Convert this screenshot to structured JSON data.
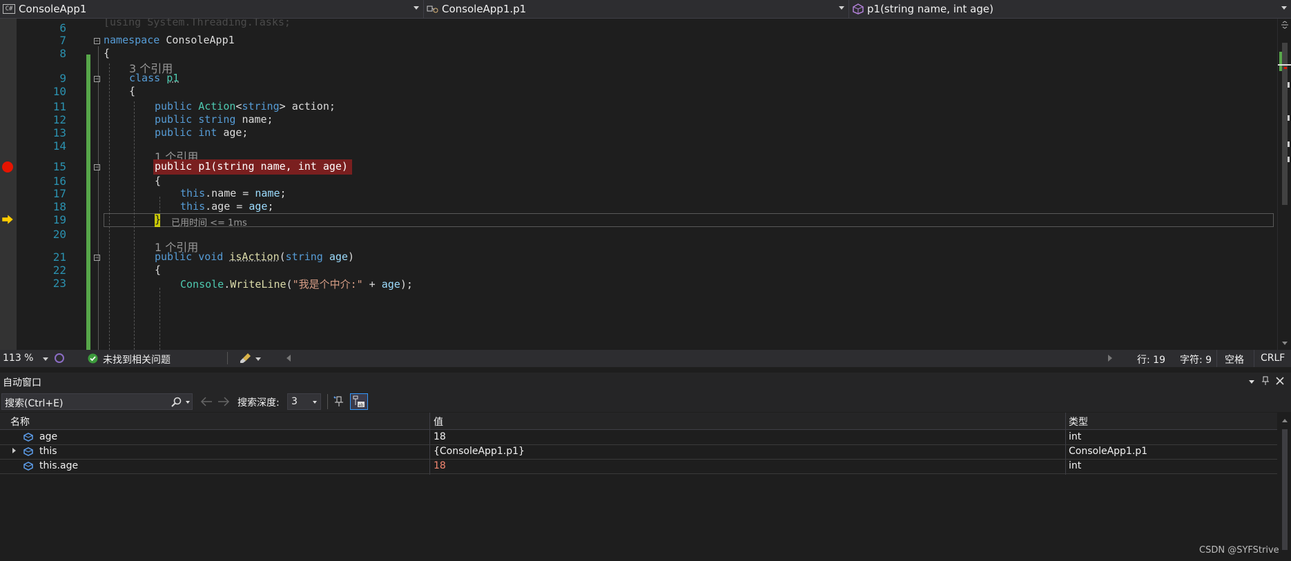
{
  "navbar": {
    "project_icon": "C#",
    "project": "ConsoleApp1",
    "type": "ConsoleApp1.p1",
    "member": "p1(string name, int age)"
  },
  "editor": {
    "line_numbers": [
      "6",
      "7",
      "8",
      "9",
      "10",
      "11",
      "12",
      "13",
      "14",
      "15",
      "16",
      "17",
      "18",
      "19",
      "20",
      "21",
      "22",
      "23"
    ],
    "codelens": {
      "class_refs": "3 个引用",
      "ctor_refs": "1 个引用",
      "method_refs": "1 个引用"
    },
    "perf_tip": "已用时间 <= 1ms",
    "code": {
      "l7_kw": "namespace",
      "l7_name": "ConsoleApp1",
      "brace_open": "{",
      "brace_close": "}",
      "l9_kw": "class",
      "l9_name": "p1",
      "public": "public",
      "l11_type": "Action",
      "l11_generic_open": "<",
      "l11_generic_type": "string",
      "l11_generic_close": ">",
      "l11_name": "action;",
      "l12_type": "string",
      "l12_name": "name;",
      "l13_type": "int",
      "l13_name": "age;",
      "l15_sig": "public p1(string name, int age)",
      "this": "this",
      "l17_field": ".name = ",
      "l17_param": "name",
      "semi": ";",
      "l18_field": ".age = ",
      "l18_param": "age",
      "l21_void": "void",
      "l21_method": "isAction",
      "l21_open": "(",
      "l21_ptype": "string",
      "l21_param": "age",
      "l21_close": ")",
      "l23_class": "Console",
      "l23_dot": ".",
      "l23_method": "WriteLine",
      "l23_open": "(",
      "l23_str": "\"我是个中介:\"",
      "l23_plus": " + ",
      "l23_param": "age",
      "l23_close": ");"
    }
  },
  "status": {
    "zoom": "113 %",
    "issues": "未找到相关问题",
    "line": "行: 19",
    "char": "字符: 9",
    "whitespace": "空格",
    "eol": "CRLF"
  },
  "autos": {
    "title": "自动窗口",
    "search_placeholder": "搜索(Ctrl+E)",
    "depth_label": "搜索深度:",
    "depth_value": "3",
    "columns": {
      "name": "名称",
      "value": "值",
      "type": "类型"
    },
    "rows": [
      {
        "name": "age",
        "value": "18",
        "type": "int",
        "changed": false
      },
      {
        "name": "this",
        "value": "{ConsoleApp1.p1}",
        "type": "ConsoleApp1.p1",
        "changed": false
      },
      {
        "name": "this.age",
        "value": "18",
        "type": "int",
        "changed": true
      }
    ]
  },
  "watermark": "CSDN @SYFStrive",
  "colors": {
    "breakpoint": "#e51400",
    "changed_value": "#f48771",
    "change_bar": "#57a64a"
  }
}
